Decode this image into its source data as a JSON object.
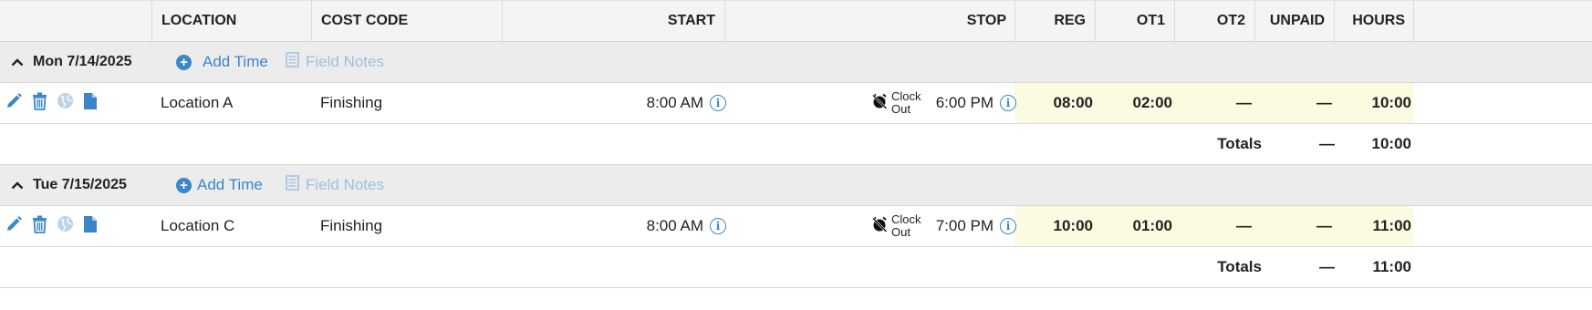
{
  "columns": {
    "location": "LOCATION",
    "cost_code": "COST CODE",
    "start": "START",
    "stop": "STOP",
    "reg": "REG",
    "ot1": "OT1",
    "ot2": "OT2",
    "unpaid": "UNPAID",
    "hours": "HOURS"
  },
  "days": [
    {
      "date": "Mon 7/14/2025",
      "add_time": "Add Time",
      "field_notes": "Field Notes",
      "entry": {
        "location": "Location A",
        "cost_code": "Finishing",
        "start": "8:00 AM",
        "clock_label_1": "Clock",
        "clock_label_2": "Out",
        "stop": "6:00 PM",
        "reg": "08:00",
        "ot1": "02:00",
        "ot2": "—",
        "unpaid": "—",
        "hours": "10:00"
      },
      "totals": {
        "label": "Totals",
        "unpaid": "—",
        "hours": "10:00"
      }
    },
    {
      "date": "Tue 7/15/2025",
      "add_time": "Add Time",
      "field_notes": "Field Notes",
      "entry": {
        "location": "Location C",
        "cost_code": "Finishing",
        "start": "8:00 AM",
        "clock_label_1": "Clock",
        "clock_label_2": "Out",
        "stop": "7:00 PM",
        "reg": "10:00",
        "ot1": "01:00",
        "ot2": "—",
        "unpaid": "—",
        "hours": "11:00"
      },
      "totals": {
        "label": "Totals",
        "unpaid": "—",
        "hours": "11:00"
      }
    }
  ],
  "icons": {
    "edit": "pencil-icon",
    "delete": "trash-icon",
    "map": "globe-icon",
    "notes": "document-icon",
    "collapse": "chevron-up-icon",
    "add": "plus-circle-icon",
    "field_notes": "notes-list-icon",
    "info": "info-icon",
    "clock_out": "no-alarm-icon"
  },
  "colors": {
    "accent": "#3b86c6",
    "muted_accent": "#9fbfdc",
    "highlight": "#fbfbe2",
    "header_bg": "#f4f4f4",
    "day_bg": "#ececec"
  }
}
